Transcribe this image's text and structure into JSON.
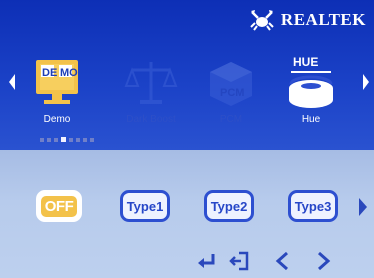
{
  "brand": {
    "name": "REALTEK",
    "logo_icon": "realtek-crab-logo"
  },
  "menu": {
    "items": [
      {
        "label": "Demo",
        "icon": "demo-monitor-icon",
        "badge_top": "DE",
        "badge_bottom": "MO",
        "active": true
      },
      {
        "label": "Dark Boost",
        "icon": "balance-scale-icon",
        "active": false
      },
      {
        "label": "PCM",
        "icon": "pcm-cube-icon",
        "active": false
      },
      {
        "label": "Hue",
        "icon": "hue-dial-icon",
        "title": "HUE",
        "active": false
      }
    ],
    "page_dots": 8,
    "active_dot": 3
  },
  "options": [
    {
      "label": "OFF",
      "selected": true
    },
    {
      "label": "Type1",
      "selected": false
    },
    {
      "label": "Type2",
      "selected": false
    },
    {
      "label": "Type3",
      "selected": false
    }
  ],
  "hotkeys": [
    {
      "name": "enter-icon"
    },
    {
      "name": "exit-icon"
    },
    {
      "name": "left-icon"
    },
    {
      "name": "right-icon"
    }
  ],
  "colors": {
    "accent": "#f3c24a",
    "panel_top": "#1c43c8",
    "panel_bottom": "#b7cbec",
    "type_button": "#2d4fd0"
  }
}
